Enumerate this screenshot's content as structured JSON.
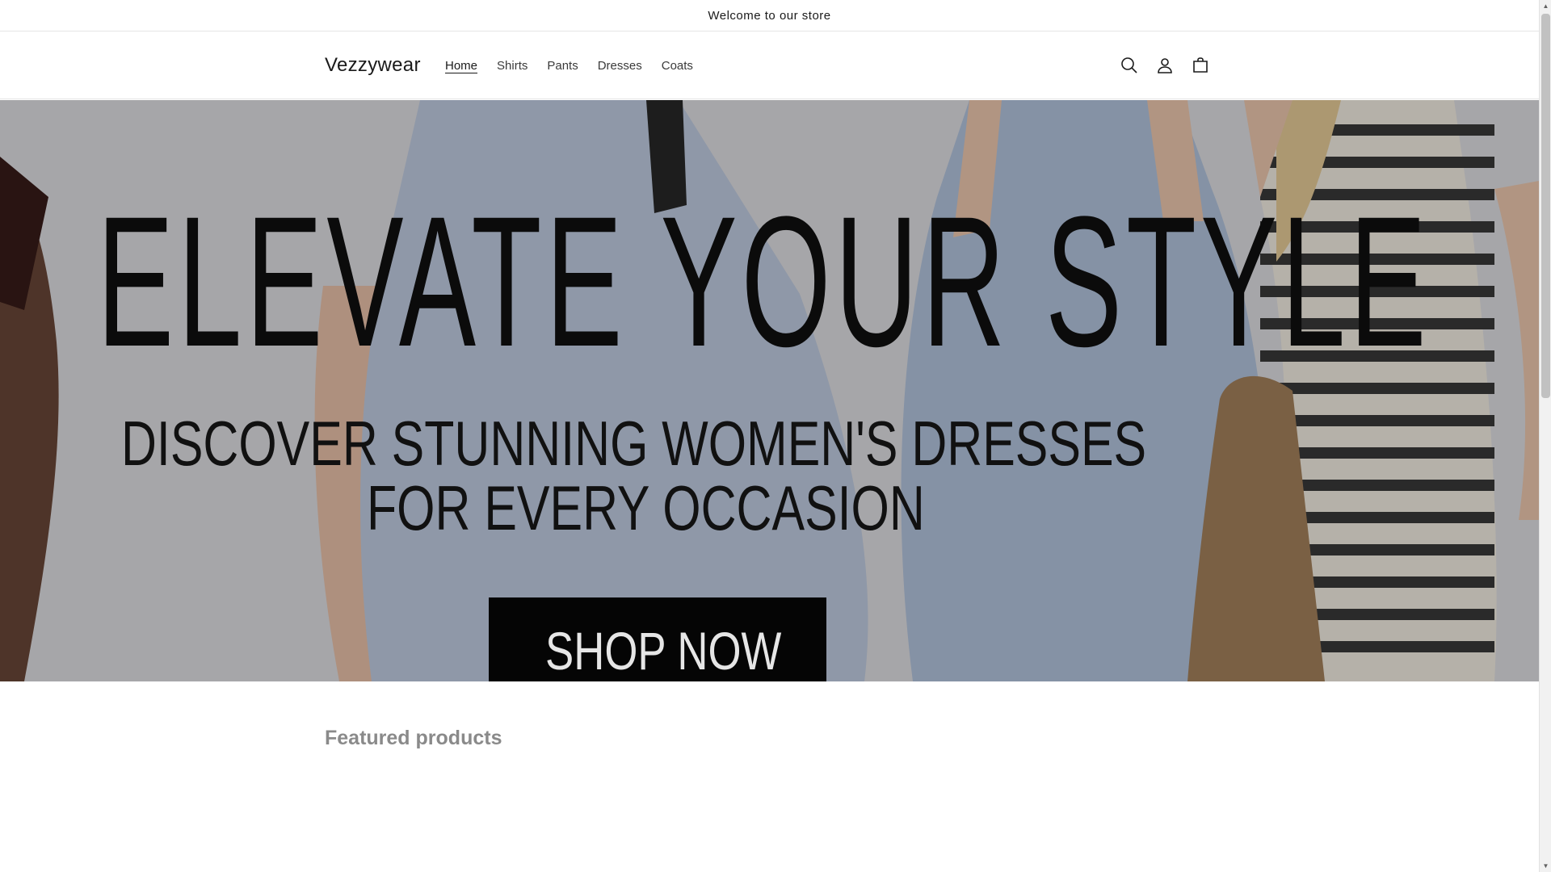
{
  "announcement": {
    "text": "Welcome to our store"
  },
  "header": {
    "logo": "Vezzywear",
    "nav": [
      {
        "label": "Home",
        "active": true
      },
      {
        "label": "Shirts",
        "active": false
      },
      {
        "label": "Pants",
        "active": false
      },
      {
        "label": "Dresses",
        "active": false
      },
      {
        "label": "Coats",
        "active": false
      }
    ],
    "icons": [
      "search-icon",
      "account-icon",
      "cart-icon"
    ]
  },
  "hero": {
    "headline": "ELEVATE YOUR STYLE",
    "subline1": "DISCOVER STUNNING WOMEN'S DRESSES",
    "subline2": "FOR EVERY OCCASION",
    "cta": "SHOP NOW",
    "colors": {
      "dress_blue": "#9fb2cf",
      "stripe_dark": "#2b2b2b",
      "stripe_light": "#e8e2d8",
      "bag": "#8a6a45"
    }
  },
  "featured": {
    "heading": "Featured products"
  }
}
